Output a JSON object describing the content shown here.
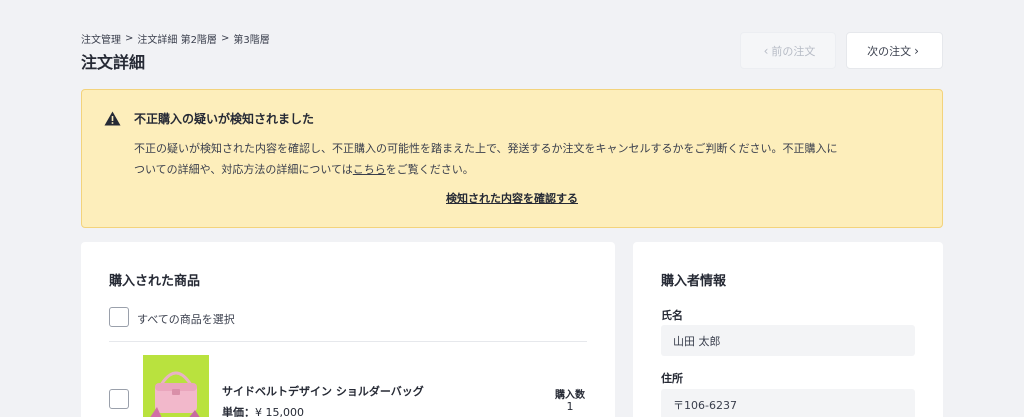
{
  "breadcrumb": [
    "注文管理",
    "注文詳細 第2階層",
    "第3階層"
  ],
  "breadcrumb_separator": ">",
  "page_title": "注文詳細",
  "nav": {
    "prev_label": "前の注文",
    "next_label": "次の注文",
    "prev_disabled": true
  },
  "alert": {
    "title": "不正購入の疑いが検知されました",
    "body_line1": "不正の疑いが検知された内容を確認し、不正購入の可能性を踏まえた上で、発送するか注文をキャンセルするかをご判断ください。不正購入に",
    "body_line2_before": "ついての詳細や、対応方法の詳細については",
    "body_link": "こちら",
    "body_line2_after": "をご覧ください。",
    "action_label": "検知された内容を確認する",
    "icon": "warning-triangle-icon"
  },
  "products": {
    "title": "購入された商品",
    "select_all_label": "すべての商品を選択",
    "items": [
      {
        "name": "サイドベルトデザイン ショルダーバッグ",
        "price_label": "単価：",
        "price": "¥ 15,000",
        "qty_label": "購入数",
        "qty": "1",
        "image": "pink-shoulder-bag-photo"
      }
    ]
  },
  "buyer": {
    "title": "購入者情報",
    "name_label": "氏名",
    "name_value": "山田 太郎",
    "address_label": "住所",
    "address_value": "〒106-6237"
  },
  "colors": {
    "background": "#f1f2f5",
    "alert_bg": "#fdeebb",
    "alert_border": "#f3d37c",
    "text": "#262a35"
  }
}
